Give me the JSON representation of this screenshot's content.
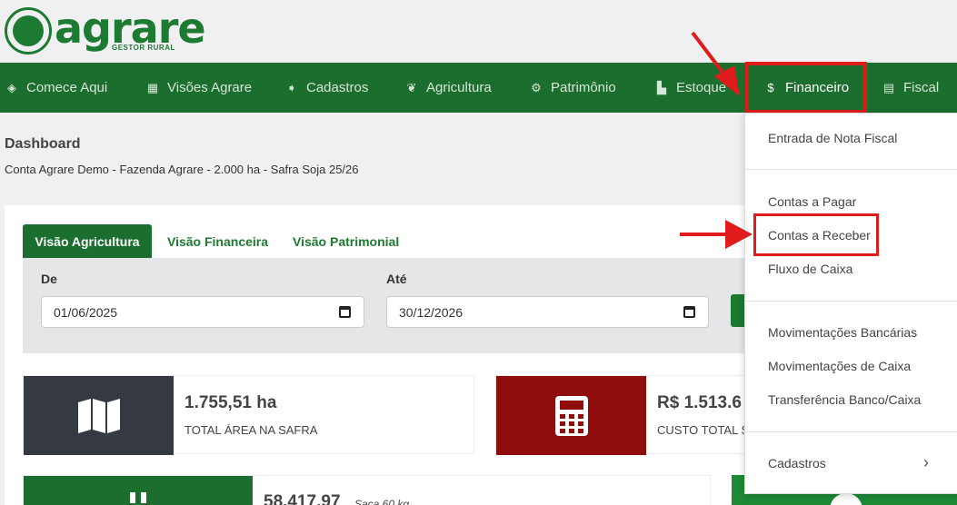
{
  "logo": {
    "name": "agrare",
    "tagline": "GESTOR RURAL"
  },
  "nav": {
    "comece": "Comece Aqui",
    "visoes": "Visões Agrare",
    "cadastros": "Cadastros",
    "agricultura": "Agricultura",
    "patrimonio": "Patrimônio",
    "estoque": "Estoque",
    "financeiro": "Financeiro",
    "fiscal": "Fiscal"
  },
  "page": {
    "title": "Dashboard",
    "subtitle": "Conta Agrare Demo - Fazenda Agrare - 2.000 ha - Safra Soja 25/26"
  },
  "tabs": {
    "agricultura": "Visão Agricultura",
    "financeira": "Visão Financeira",
    "patrimonial": "Visão Patrimonial"
  },
  "filter": {
    "de_label": "De",
    "de_value": "01/06/2025",
    "ate_label": "Até",
    "ate_value": "30/12/2026"
  },
  "cards": {
    "area_value": "1.755,51 ha",
    "area_label": "TOTAL ÁREA NA SAFRA",
    "custo_value": "R$ 1.513.6",
    "custo_label": "CUSTO TOTAL S",
    "sacas_value": "58.417,97",
    "sacas_unit": "Saca 60 kg"
  },
  "menu": {
    "nota_fiscal": "Entrada de Nota Fiscal",
    "contas_pagar": "Contas a Pagar",
    "contas_receber": "Contas a Receber",
    "fluxo_caixa": "Fluxo de Caixa",
    "mov_bancarias": "Movimentações Bancárias",
    "mov_caixa": "Movimentações de Caixa",
    "transferencia": "Transferência Banco/Caixa",
    "cadastros": "Cadastros",
    "chevron": "›"
  },
  "colors": {
    "brand_green": "#1b6e2d",
    "highlight_red": "#e01b1b",
    "card_dark": "#353a42",
    "card_red": "#8f0d0d"
  }
}
